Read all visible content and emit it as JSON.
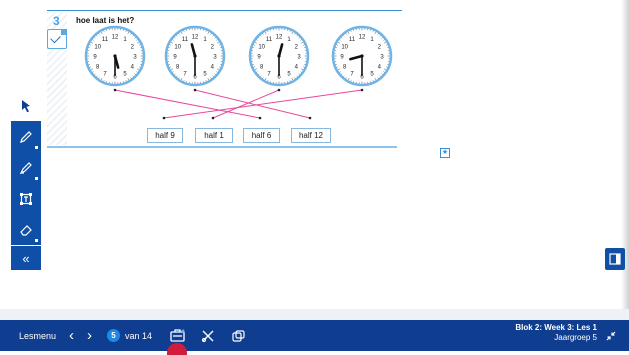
{
  "exercise": {
    "number": "3",
    "title": "hoe laat is het?",
    "clocks": [
      {
        "hour": 5,
        "minute": 30
      },
      {
        "hour": 11,
        "minute": 30
      },
      {
        "hour": 12,
        "minute": 30
      },
      {
        "hour": 8,
        "minute": 30
      }
    ],
    "clock_numbers": [
      "12",
      "1",
      "2",
      "3",
      "4",
      "5",
      "6",
      "7",
      "8",
      "9",
      "10",
      "11"
    ],
    "answers": [
      "half 9",
      "half 1",
      "half 6",
      "half 12"
    ],
    "connections": [
      {
        "clock": 0,
        "answer": 2
      },
      {
        "clock": 1,
        "answer": 3
      },
      {
        "clock": 2,
        "answer": 1
      },
      {
        "clock": 3,
        "answer": 0
      }
    ],
    "line_color": "#e8489a"
  },
  "toolbar": {
    "tools": [
      "pointer-icon",
      "pencil-icon",
      "highlighter-icon",
      "text-box-icon",
      "eraser-icon"
    ],
    "expand_label": "«"
  },
  "bottombar": {
    "menu_label": "Lesmenu",
    "prev_icon": "‹",
    "next_icon": "›",
    "current_page": "5",
    "page_of": "van 14",
    "lesson_title": "Blok 2: Week 3: Les 1",
    "group": "Jaargroep 5"
  },
  "colors": {
    "primary": "#0f3d8f",
    "accent": "#1e88e5",
    "magenta": "#e8489a",
    "indicator": "#d21c3c"
  }
}
